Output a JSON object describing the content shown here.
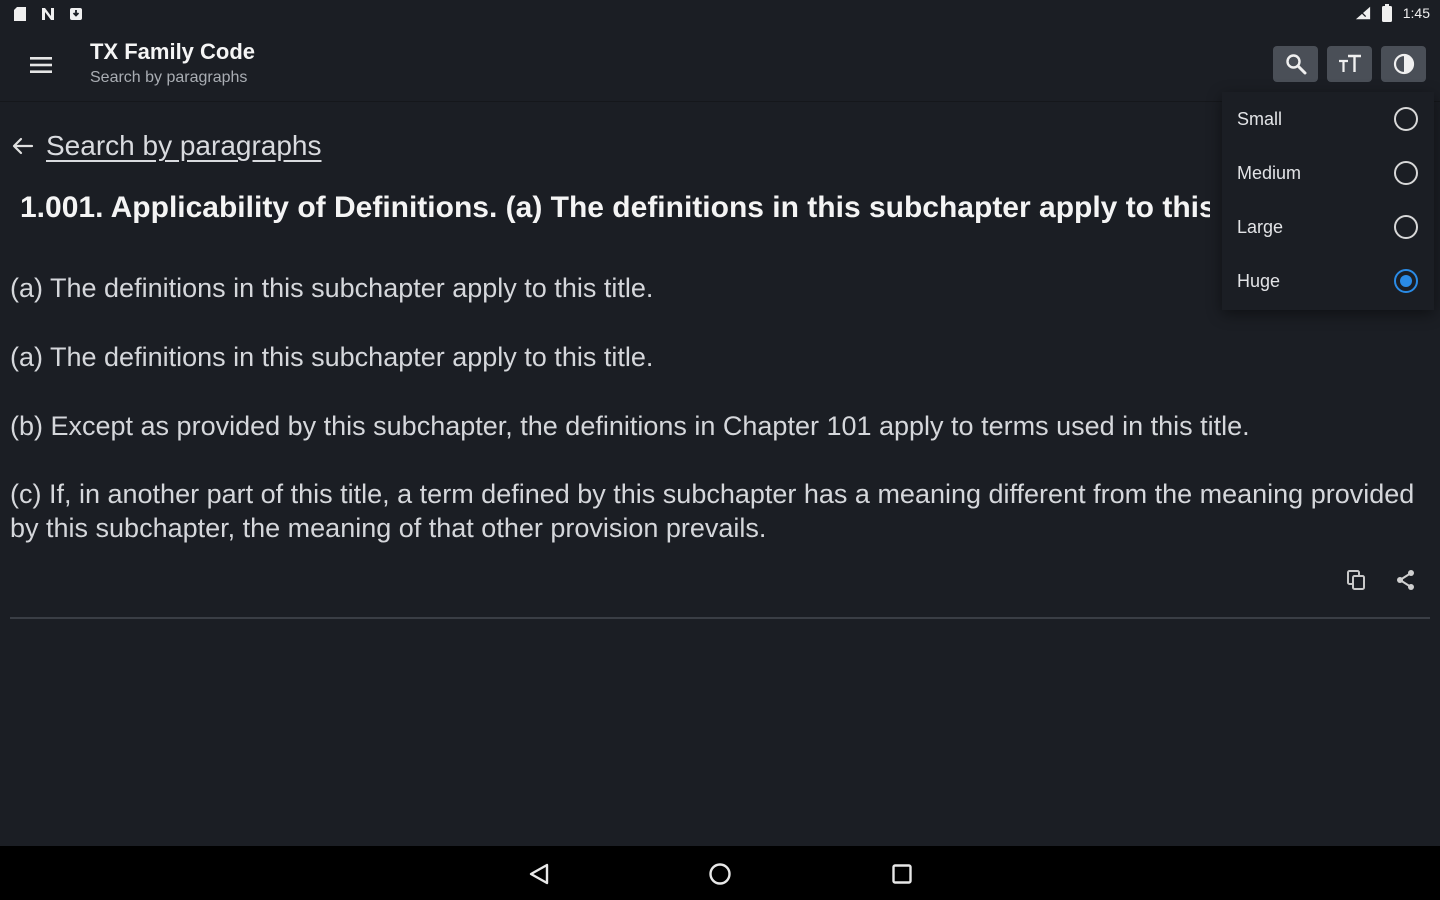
{
  "status_bar": {
    "time": "1:45",
    "left_icons": [
      "sd-card-icon",
      "n-icon",
      "download-icon"
    ],
    "right_icons": [
      "signal-icon",
      "battery-icon"
    ]
  },
  "app_bar": {
    "title": "TX Family Code",
    "subtitle": "Search by paragraphs",
    "buttons": [
      "search-icon",
      "text-size-icon",
      "contrast-icon"
    ]
  },
  "content": {
    "back_label": "Search by paragraphs",
    "section_title": "1.001. Applicability of Definitions. (a) The definitions in this subchapter apply to this title.",
    "paragraphs": [
      "(a) The definitions in this subchapter apply to this title.",
      "(a) The definitions in this subchapter apply to this title.",
      "(b) Except as provided by this subchapter, the definitions in Chapter 101 apply to terms used in this title.",
      "(c) If, in another part of this title, a term defined by this subchapter has a meaning different from the meaning provided by this subchapter, the meaning of that other provision prevails."
    ],
    "actions": [
      "copy-icon",
      "share-icon"
    ]
  },
  "text_size_menu": {
    "options": [
      {
        "label": "Small",
        "selected": false
      },
      {
        "label": "Medium",
        "selected": false
      },
      {
        "label": "Large",
        "selected": false
      },
      {
        "label": "Huge",
        "selected": true
      }
    ]
  },
  "colors": {
    "background": "#1b1e24",
    "toolbar_button": "#4a4f57",
    "accent": "#2a8be6"
  }
}
